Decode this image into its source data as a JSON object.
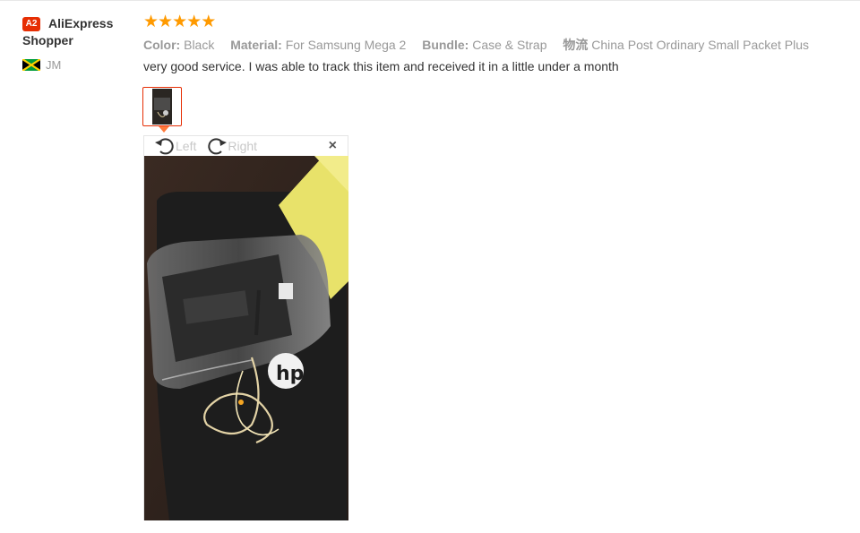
{
  "buyer": {
    "badge": "A2",
    "name_line1": "AliExpress",
    "name_line2": "Shopper",
    "country_code": "JM"
  },
  "review": {
    "rating": 5,
    "stars": [
      "★",
      "★",
      "★",
      "★",
      "★"
    ],
    "attributes": [
      {
        "key": "Color:",
        "value": "Black"
      },
      {
        "key": "Material:",
        "value": "For Samsung Mega 2"
      },
      {
        "key": "Bundle:",
        "value": "Case & Strap"
      },
      {
        "key": "物流",
        "value": "China Post Ordinary Small Packet Plus"
      }
    ],
    "text": "very good service. I was able to track this item and received it in a little under a month"
  },
  "viewer": {
    "rotate_left_label": "Left",
    "rotate_right_label": "Right",
    "close_label": "×"
  },
  "colors": {
    "accent": "#e62e04",
    "star": "#ff9a00",
    "muted": "#999999"
  },
  "icons": {
    "rotate_left": "rotate-left-icon",
    "rotate_right": "rotate-right-icon",
    "close": "close-icon",
    "flag": "jamaica-flag-icon"
  }
}
